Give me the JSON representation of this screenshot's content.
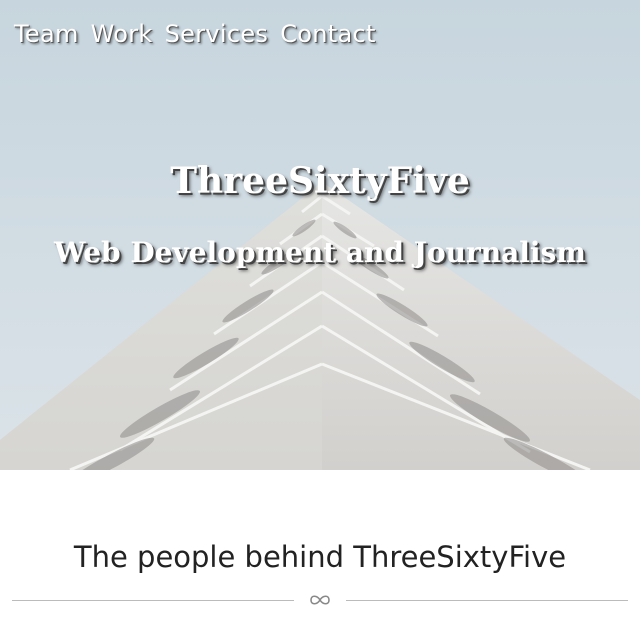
{
  "nav": {
    "items": [
      {
        "label": "Team"
      },
      {
        "label": "Work"
      },
      {
        "label": "Services"
      },
      {
        "label": "Contact"
      }
    ]
  },
  "hero": {
    "title": "ThreeSixtyFive",
    "subtitle": "Web Development and Journalism"
  },
  "section": {
    "heading": "The people behind ThreeSixtyFive",
    "divider_icon": "infinity-icon"
  }
}
